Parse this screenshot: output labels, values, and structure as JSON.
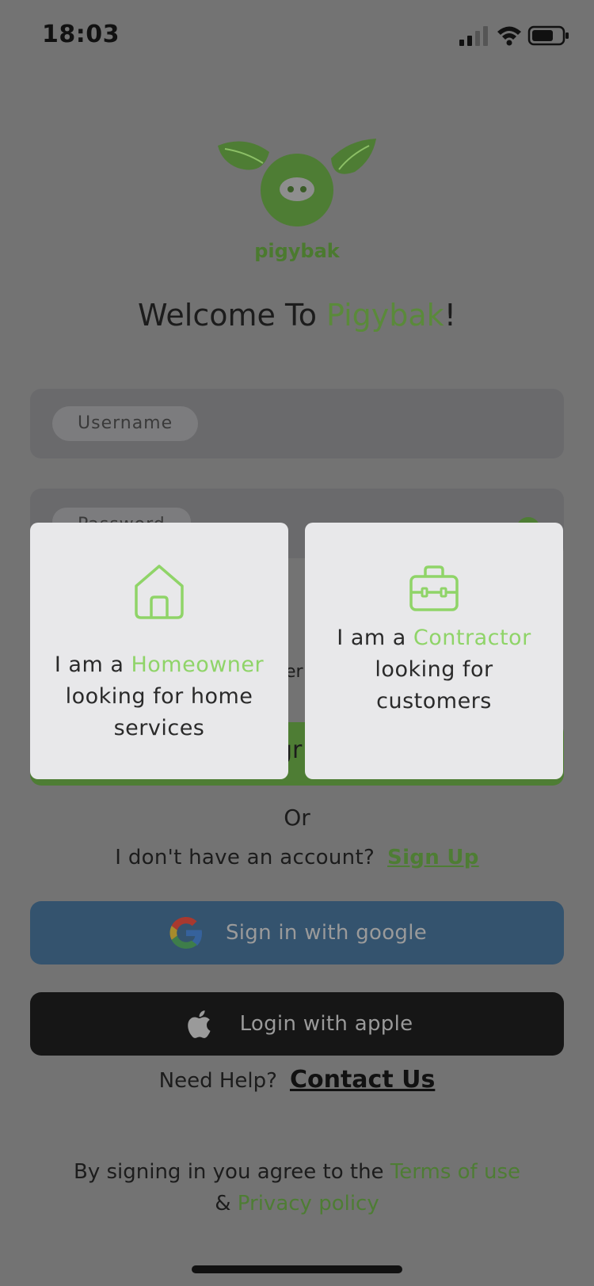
{
  "status_bar": {
    "time": "18:03"
  },
  "logo": {
    "text": "pigybak"
  },
  "welcome": {
    "prefix": "Welcome To ",
    "brand": "Pigybak",
    "suffix": "!"
  },
  "form": {
    "username_label": "Username",
    "password_label": "Password",
    "remember_fragment": "er",
    "signin_fragment": "gr"
  },
  "or_text": "Or",
  "signup": {
    "prompt": "I don't have an account?",
    "link": "Sign Up"
  },
  "google_button": {
    "label": "Sign in with google",
    "icon": "google-icon"
  },
  "apple_button": {
    "label": "Login with apple",
    "icon": "apple-icon"
  },
  "help": {
    "prompt": "Need Help?",
    "link": "Contact Us"
  },
  "terms": {
    "prefix": "By signing in you agree to the ",
    "terms_link": "Terms of use",
    "amp": "& ",
    "privacy_link": "Privacy policy"
  },
  "role_cards": {
    "homeowner": {
      "line_pre": "I am a ",
      "role": "Homeowner",
      "rest": "looking for home services",
      "icon": "house-icon"
    },
    "contractor": {
      "line_pre": "I am a ",
      "role": "Contractor",
      "rest": "looking for customers",
      "icon": "briefcase-icon"
    }
  },
  "colors": {
    "accent_green": "#5a8a3a",
    "card_accent": "#8fd468",
    "overlay_bg": "#737373"
  }
}
